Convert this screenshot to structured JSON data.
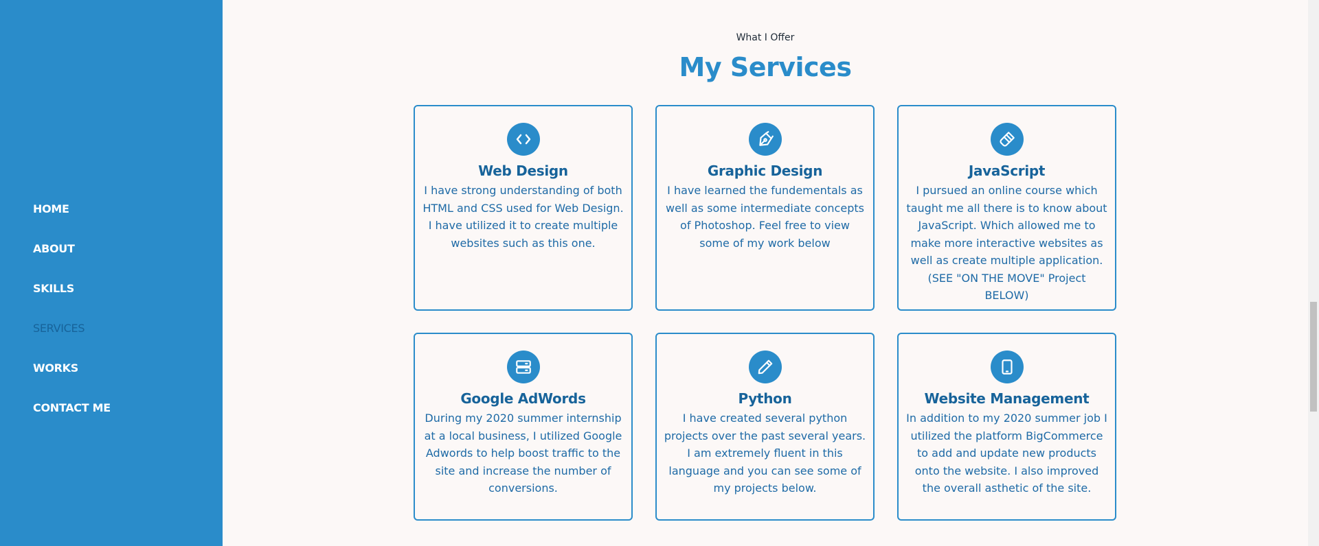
{
  "nav": {
    "items": [
      {
        "label": "HOME"
      },
      {
        "label": "ABOUT"
      },
      {
        "label": "SKILLS"
      },
      {
        "label": "SERVICES"
      },
      {
        "label": "WORKS"
      },
      {
        "label": "CONTACT ME"
      }
    ],
    "active": "SERVICES"
  },
  "section": {
    "eyebrow": "What I Offer",
    "title": "My Services"
  },
  "services": [
    {
      "icon": "code-icon",
      "title": "Web Design",
      "text": "I have strong understanding of both HTML and CSS used for Web Design. I have utilized it to create multiple websites such as this one."
    },
    {
      "icon": "pen-nib-icon",
      "title": "Graphic Design",
      "text": "I have learned the fundementals as well as some intermediate concepts of Photoshop. Feel free to view some of my work below"
    },
    {
      "icon": "paint-brush-icon",
      "title": "JavaScript",
      "text": "I pursued an online course which taught me all there is to know about JavaScript. Which allowed me to make more interactive websites as well as create multiple application. (SEE \"ON THE MOVE\" Project BELOW)"
    },
    {
      "icon": "server-icon",
      "title": "Google AdWords",
      "text": "During my 2020 summer internship at a local business, I utilized Google Adwords to help boost traffic to the site and increase the number of conversions."
    },
    {
      "icon": "pencil-icon",
      "title": "Python",
      "text": "I have created several python projects over the past several years. I am extremely fluent in this language and you can see some of my projects below."
    },
    {
      "icon": "tablet-icon",
      "title": "Website Management",
      "text": "In addition to my 2020 summer job I utilized the platform BigCommerce to add and update new products onto the website. I also improved the overall asthetic of the site."
    }
  ],
  "colors": {
    "accent": "#2a8cca",
    "title": "#17639a",
    "background": "#fcf8f7"
  }
}
